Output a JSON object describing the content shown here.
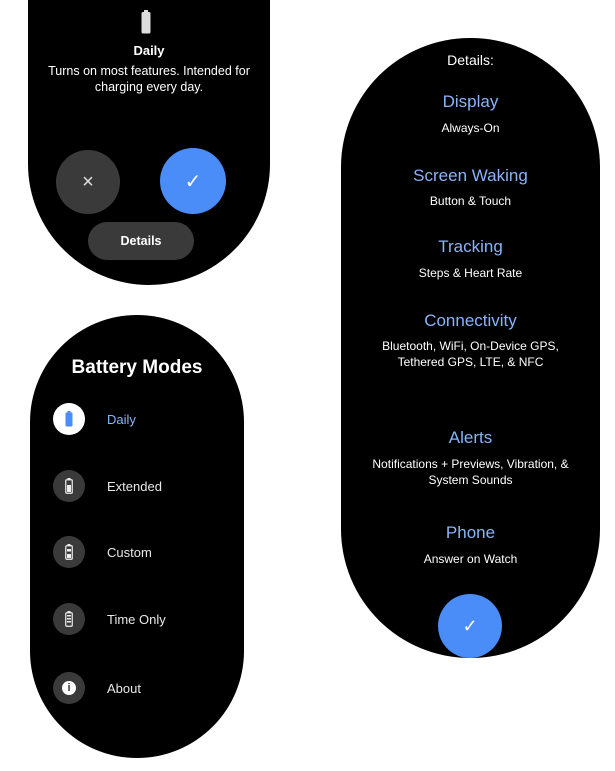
{
  "daily_confirm": {
    "title": "Daily",
    "description": "Turns on most features. Intended for charging every day.",
    "cancel_icon": "×",
    "confirm_icon": "✓",
    "details_label": "Details",
    "accent": "#4b8df8"
  },
  "modes": {
    "heading": "Battery Modes",
    "items": [
      {
        "label": "Daily",
        "icon": "battery-full-icon",
        "active": true
      },
      {
        "label": "Extended",
        "icon": "battery-medium-icon",
        "active": false
      },
      {
        "label": "Custom",
        "icon": "battery-custom-icon",
        "active": false
      },
      {
        "label": "Time Only",
        "icon": "battery-low-icon",
        "active": false
      },
      {
        "label": "About",
        "icon": "info-icon",
        "active": false
      }
    ],
    "info_glyph": "i"
  },
  "details": {
    "title": "Details:",
    "sections": [
      {
        "heading": "Display",
        "body": "Always-On"
      },
      {
        "heading": "Screen Waking",
        "body": "Button & Touch"
      },
      {
        "heading": "Tracking",
        "body": "Steps & Heart Rate"
      },
      {
        "heading": "Connectivity",
        "body": "Bluetooth, WiFi, On-Device GPS, Tethered GPS, LTE, & NFC"
      },
      {
        "heading": "Alerts",
        "body": "Notifications + Previews, Vibration, & System Sounds"
      },
      {
        "heading": "Phone",
        "body": "Answer on Watch"
      }
    ],
    "done_icon": "✓",
    "heading_color": "#8ab4f8"
  }
}
